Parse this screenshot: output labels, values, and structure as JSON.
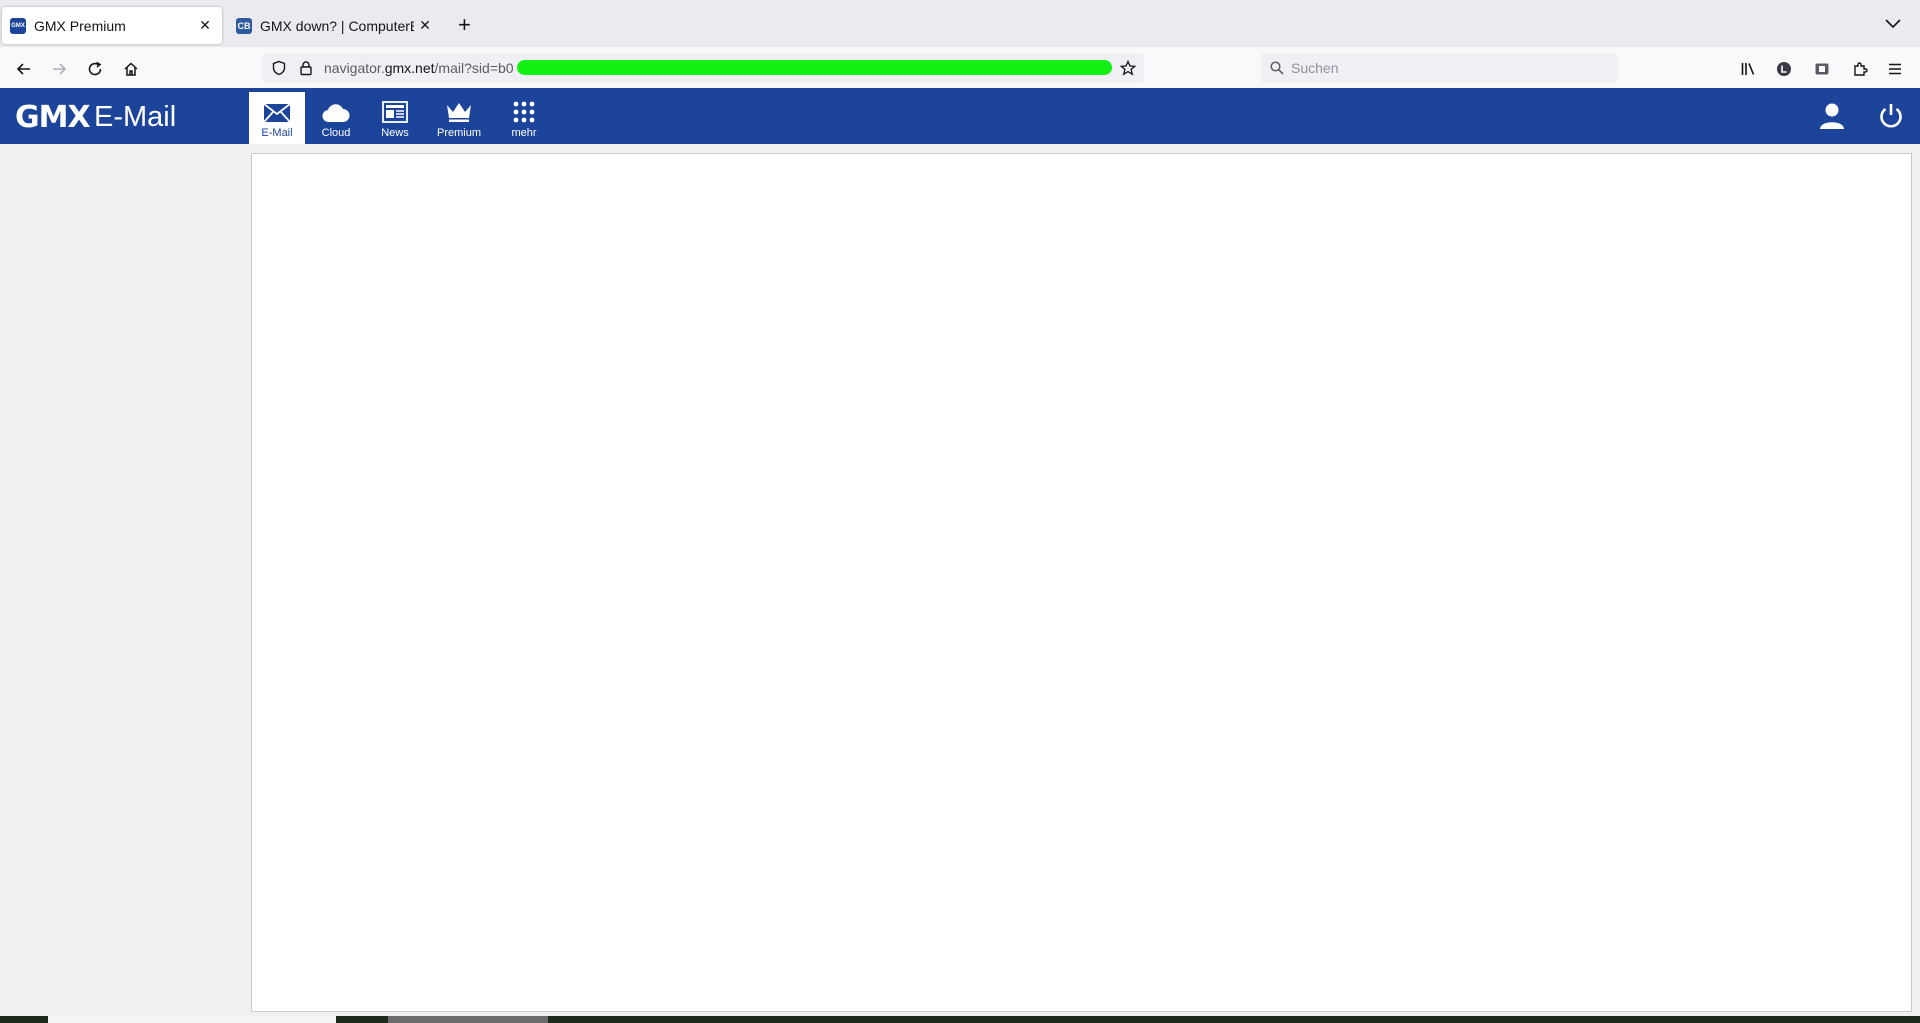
{
  "browser": {
    "tabs": [
      {
        "title": "GMX Premium",
        "favicon": "GMX",
        "active": true
      },
      {
        "title": "GMX down? | ComputerBase Fo",
        "favicon": "CB",
        "active": false
      }
    ],
    "url": {
      "prefix": "navigator.",
      "host": "gmx.net",
      "path": "/mail?sid=b0"
    },
    "search_placeholder": "Suchen"
  },
  "app": {
    "logo": "GMX",
    "product": "E-Mail",
    "nav": [
      {
        "label": "E-Mail",
        "icon": "envelope-icon",
        "active": true
      },
      {
        "label": "Cloud",
        "icon": "cloud-icon",
        "active": false
      },
      {
        "label": "News",
        "icon": "newspaper-icon",
        "active": false
      },
      {
        "label": "Premium",
        "icon": "crown-icon",
        "active": false
      },
      {
        "label": "mehr",
        "icon": "grid-icon",
        "active": false
      }
    ],
    "brand_color": "#1c449b"
  }
}
